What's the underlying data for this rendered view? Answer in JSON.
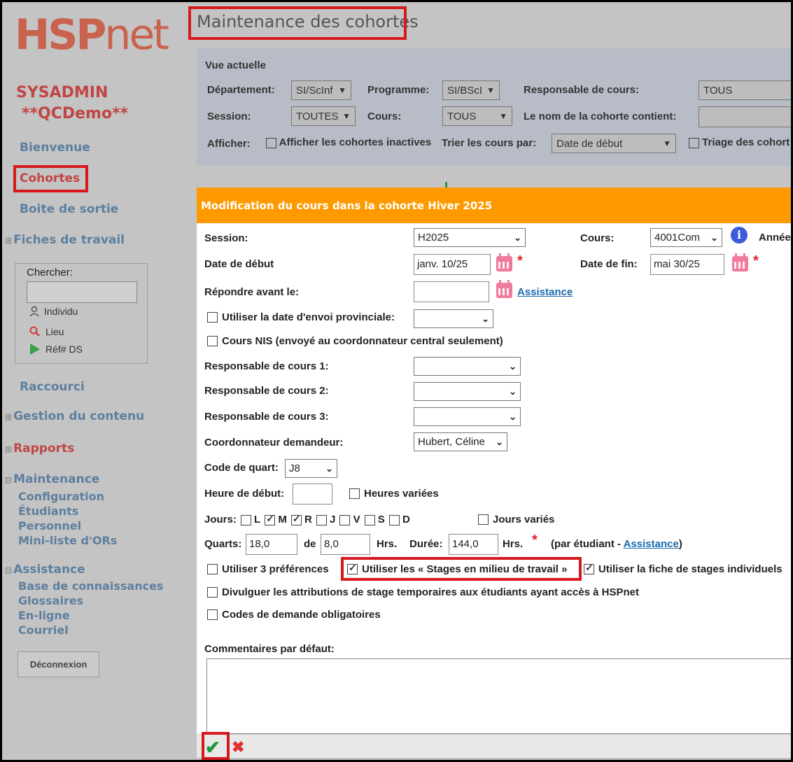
{
  "logo": {
    "bold": "HSP",
    "rest": "net"
  },
  "user": {
    "role": "SYSADMIN",
    "instance": "**QCDemo**"
  },
  "sidebar": {
    "welcome": "Bienvenue",
    "cohorts": "Cohortes",
    "outbox": "Boite de sortie",
    "worksheets": "Fiches de travail",
    "search": {
      "label": "Chercher:",
      "options": [
        "Individu",
        "Lieu",
        "Réf# DS"
      ]
    },
    "shortcut": "Raccourci",
    "content": "Gestion du contenu",
    "reports": "Rapports",
    "maintenance": {
      "label": "Maintenance",
      "items": [
        "Configuration",
        "Étudiants",
        "Personnel",
        "Mini-liste d'ORs"
      ]
    },
    "help": {
      "label": "Assistance",
      "items": [
        "Base de connaissances",
        "Glossaires",
        "En-ligne",
        "Courriel"
      ]
    },
    "logout": "Déconnexion"
  },
  "page": {
    "title": "Maintenance des cohortes"
  },
  "filters": {
    "heading": "Vue actuelle",
    "department_label": "Département:",
    "department_value": "SI/ScInf",
    "program_label": "Programme:",
    "program_value": "SI/BScI",
    "coordinator_label": "Responsable de cours:",
    "coordinator_value": "TOUS",
    "session_label": "Session:",
    "session_value": "TOUTES",
    "course_label": "Cours:",
    "course_value": "TOUS",
    "name_label": "Le nom de la cohorte contient:",
    "show_label": "Afficher:",
    "show_inactive": "Afficher les cohortes inactives",
    "sort_label": "Trier les cours par:",
    "sort_value": "Date de début",
    "sort_cohorts": "Triage des cohort"
  },
  "dialog": {
    "title": "Modification du cours dans la cohorte Hiver 2025",
    "session_label": "Session:",
    "session_value": "H2025",
    "course_label": "Cours:",
    "course_value": "4001Com",
    "year_label": "Année",
    "start_label": "Date de début",
    "start_value": "janv. 10/25",
    "end_label": "Date de fin:",
    "end_value": "mai 30/25",
    "reply_label": "Répondre avant le:",
    "reply_help": "Assistance",
    "provincial_label": "Utiliser la date d'envoi provinciale:",
    "nis_label": "Cours NIS (envoyé au coordonnateur central seulement)",
    "coord1_label": "Responsable de cours 1:",
    "coord2_label": "Responsable de cours 2:",
    "coord3_label": "Responsable de cours 3:",
    "requester_label": "Coordonnateur demandeur:",
    "requester_value": "Hubert, Céline",
    "shift_label": "Code de quart:",
    "shift_value": "J8",
    "start_time_label": "Heure de début:",
    "varied_hours": "Heures variées",
    "days_label": "Jours:",
    "days": [
      {
        "label": "L",
        "checked": false
      },
      {
        "label": "M",
        "checked": true
      },
      {
        "label": "R",
        "checked": true
      },
      {
        "label": "J",
        "checked": false
      },
      {
        "label": "V",
        "checked": false
      },
      {
        "label": "S",
        "checked": false
      },
      {
        "label": "D",
        "checked": false
      }
    ],
    "varied_days": "Jours variés",
    "shifts_label": "Quarts:",
    "shifts_value": "18,0",
    "of_label": "de",
    "of_value": "8,0",
    "hrs1": "Hrs.",
    "duration_label": "Durée:",
    "duration_value": "144,0",
    "hrs2": "Hrs.",
    "per_student": "(par étudiant -",
    "per_student_link": "Assistance",
    "per_student_end": ")",
    "pref3": "Utiliser 3 préférences",
    "workplace": "Utiliser les « Stages en milieu de travail »",
    "individual": "Utiliser la fiche de stages individuels",
    "disclose": "Divulguer les attributions de stage temporaires aux étudiants ayant accès à HSPnet",
    "mandatory_codes": "Codes de demande obligatoires",
    "comments_label": "Commentaires par défaut:",
    "save_icon": "✔",
    "cancel_icon": "✖"
  }
}
